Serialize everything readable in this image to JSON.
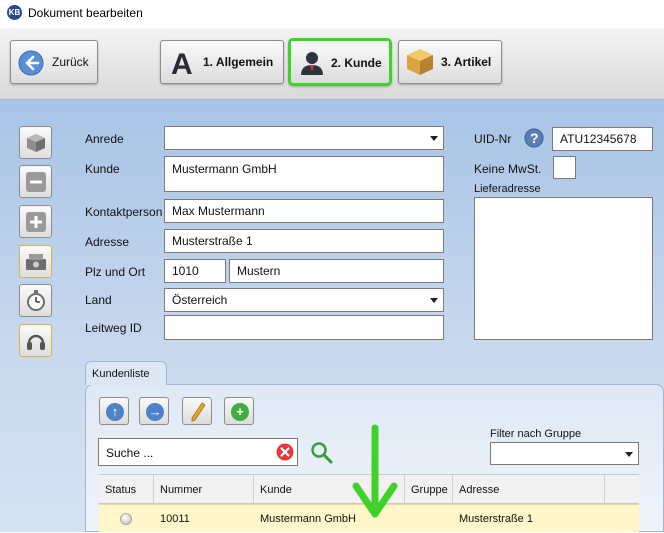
{
  "window": {
    "app_icon": "KB",
    "title": "Dokument bearbeiten"
  },
  "toolbar": {
    "back_label": "Zurück",
    "tabs": [
      {
        "label": "1. Allgemein",
        "icon": "letter-a-icon"
      },
      {
        "label": "2. Kunde",
        "icon": "user-icon",
        "active": true
      },
      {
        "label": "3. Artikel",
        "icon": "box-icon"
      }
    ],
    "active_color": "#3fd22a"
  },
  "form": {
    "anrede": {
      "label": "Anrede",
      "value": ""
    },
    "kunde": {
      "label": "Kunde",
      "value": "Mustermann GmbH"
    },
    "kontaktperson": {
      "label": "Kontaktperson",
      "value": "Max Mustermann"
    },
    "adresse": {
      "label": "Adresse",
      "value": "Musterstraße 1"
    },
    "plz_ort": {
      "label": "Plz und Ort",
      "plz": "1010",
      "ort": "Mustern"
    },
    "land": {
      "label": "Land",
      "value": "Österreich"
    },
    "leitweg": {
      "label": "Leitweg ID",
      "value": ""
    },
    "uid": {
      "label": "UID-Nr",
      "value": "ATU12345678"
    },
    "keine_mwst": {
      "label": "Keine MwSt.",
      "checked": false
    },
    "lieferadresse": {
      "label": "Lieferadresse",
      "value": ""
    }
  },
  "kundenliste": {
    "tab_label": "Kundenliste",
    "search_placeholder": "Suche ...",
    "filter_label": "Filter nach Gruppe",
    "filter_value": "",
    "columns": [
      "Status",
      "Nummer",
      "Kunde",
      "Gruppe",
      "Adresse"
    ],
    "rows": [
      {
        "status": "",
        "nummer": "10011",
        "kunde": "Mustermann GmbH",
        "gruppe": "",
        "adresse": "Musterstraße 1"
      }
    ]
  }
}
